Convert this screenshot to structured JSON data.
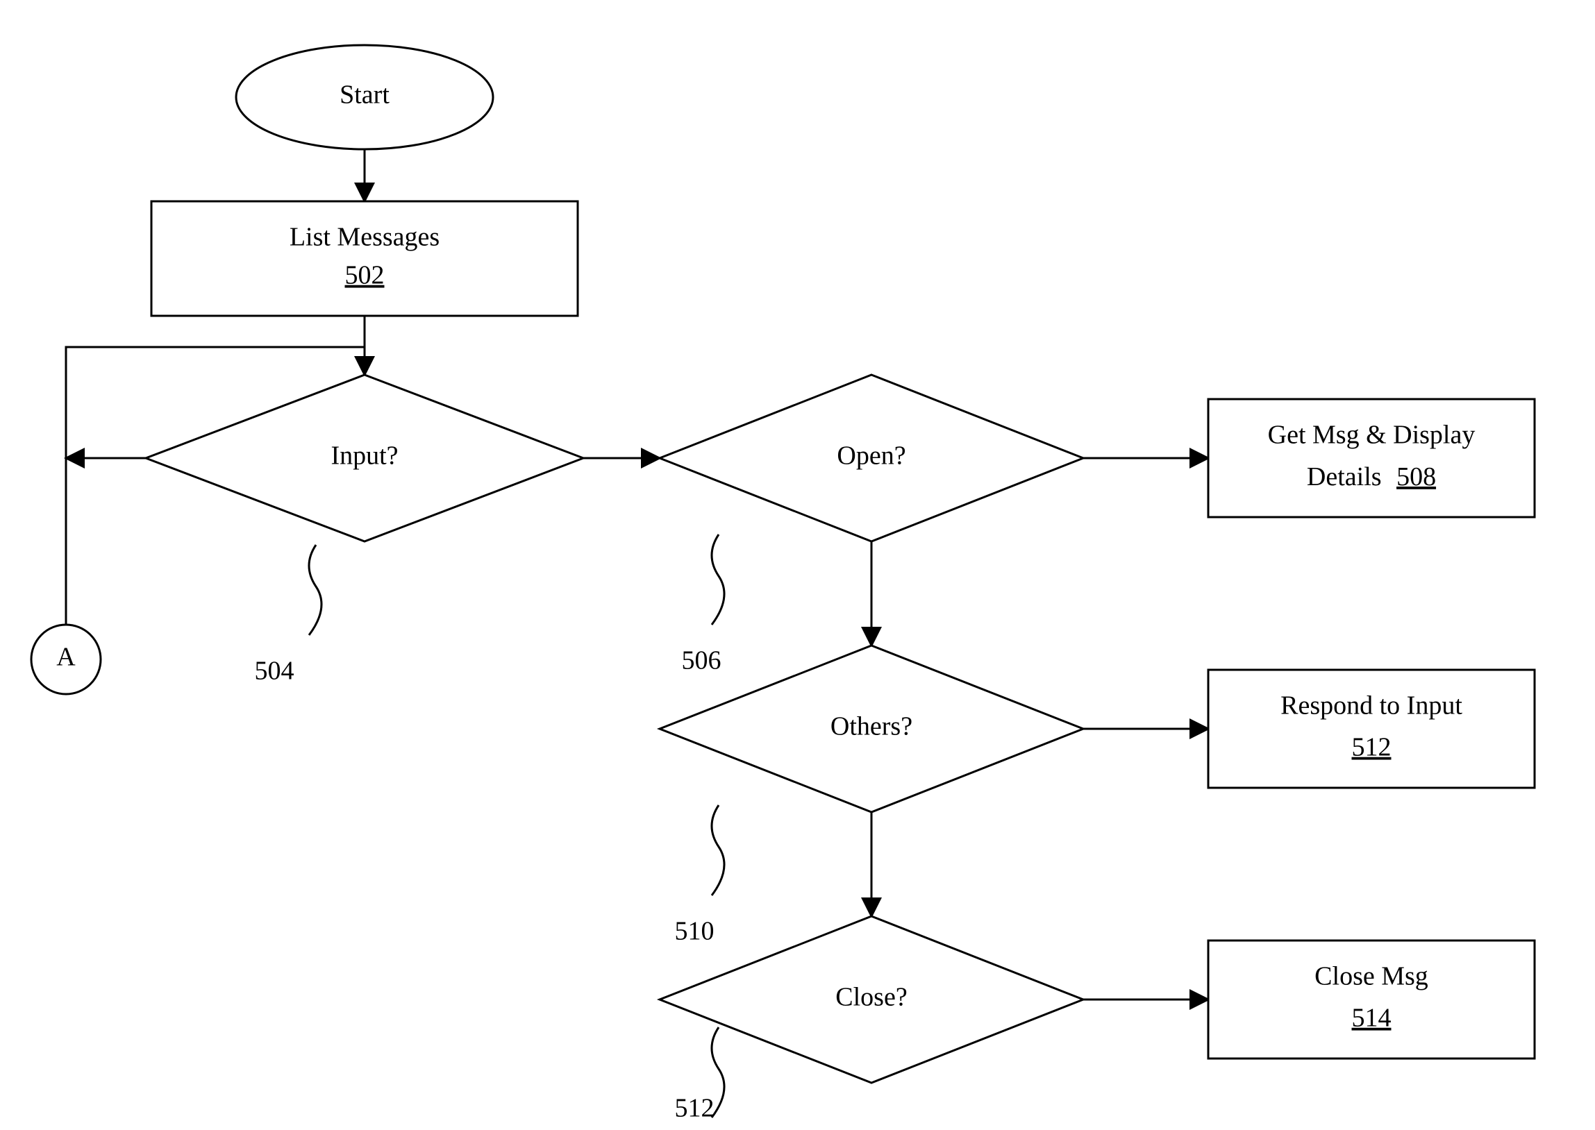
{
  "nodes": {
    "start": {
      "label": "Start"
    },
    "list": {
      "label": "List Messages",
      "ref": "502"
    },
    "input": {
      "label": "Input?",
      "ref": "504"
    },
    "open": {
      "label": "Open?",
      "ref": "506"
    },
    "others": {
      "label": "Others?",
      "ref": "510"
    },
    "close": {
      "label": "Close?",
      "ref": "512"
    },
    "getmsg": {
      "label": "Get Msg & Display",
      "label2": "Details",
      "ref": "508"
    },
    "respond": {
      "label": "Respond to Input",
      "ref": "512"
    },
    "closemsg": {
      "label": "Close Msg",
      "ref": "514"
    },
    "connA": {
      "label": "A"
    }
  }
}
